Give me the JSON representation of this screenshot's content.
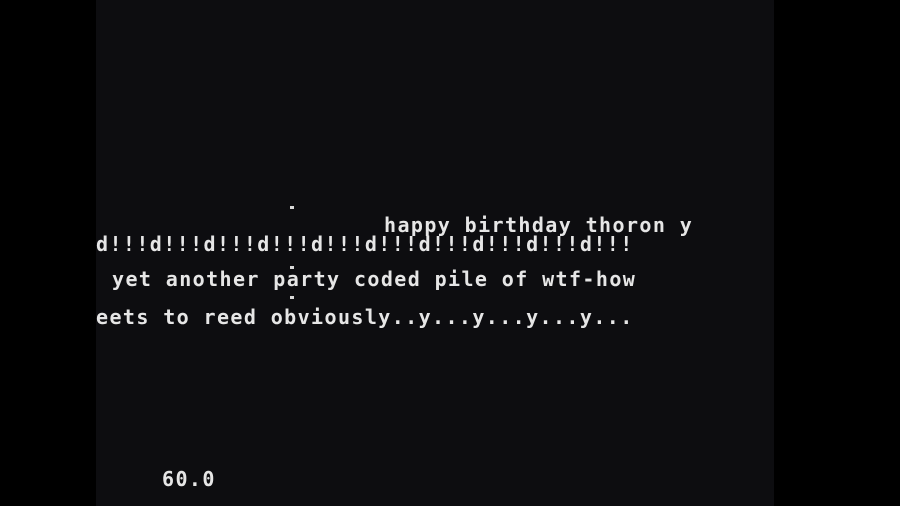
{
  "scroller": {
    "line1": "happy birthday thoron y",
    "line2": "d!!!d!!!d!!!d!!!d!!!d!!!d!!!d!!!d!!!d!!!",
    "line3": "yet another party coded pile of wtf-how",
    "line4": "eets to reed obviously..y...y...y...y..."
  },
  "hud": {
    "counter": "60.0"
  },
  "colors": {
    "background": "#0d0d10",
    "letterbox": "#000000",
    "text": "#e6e6e6"
  }
}
